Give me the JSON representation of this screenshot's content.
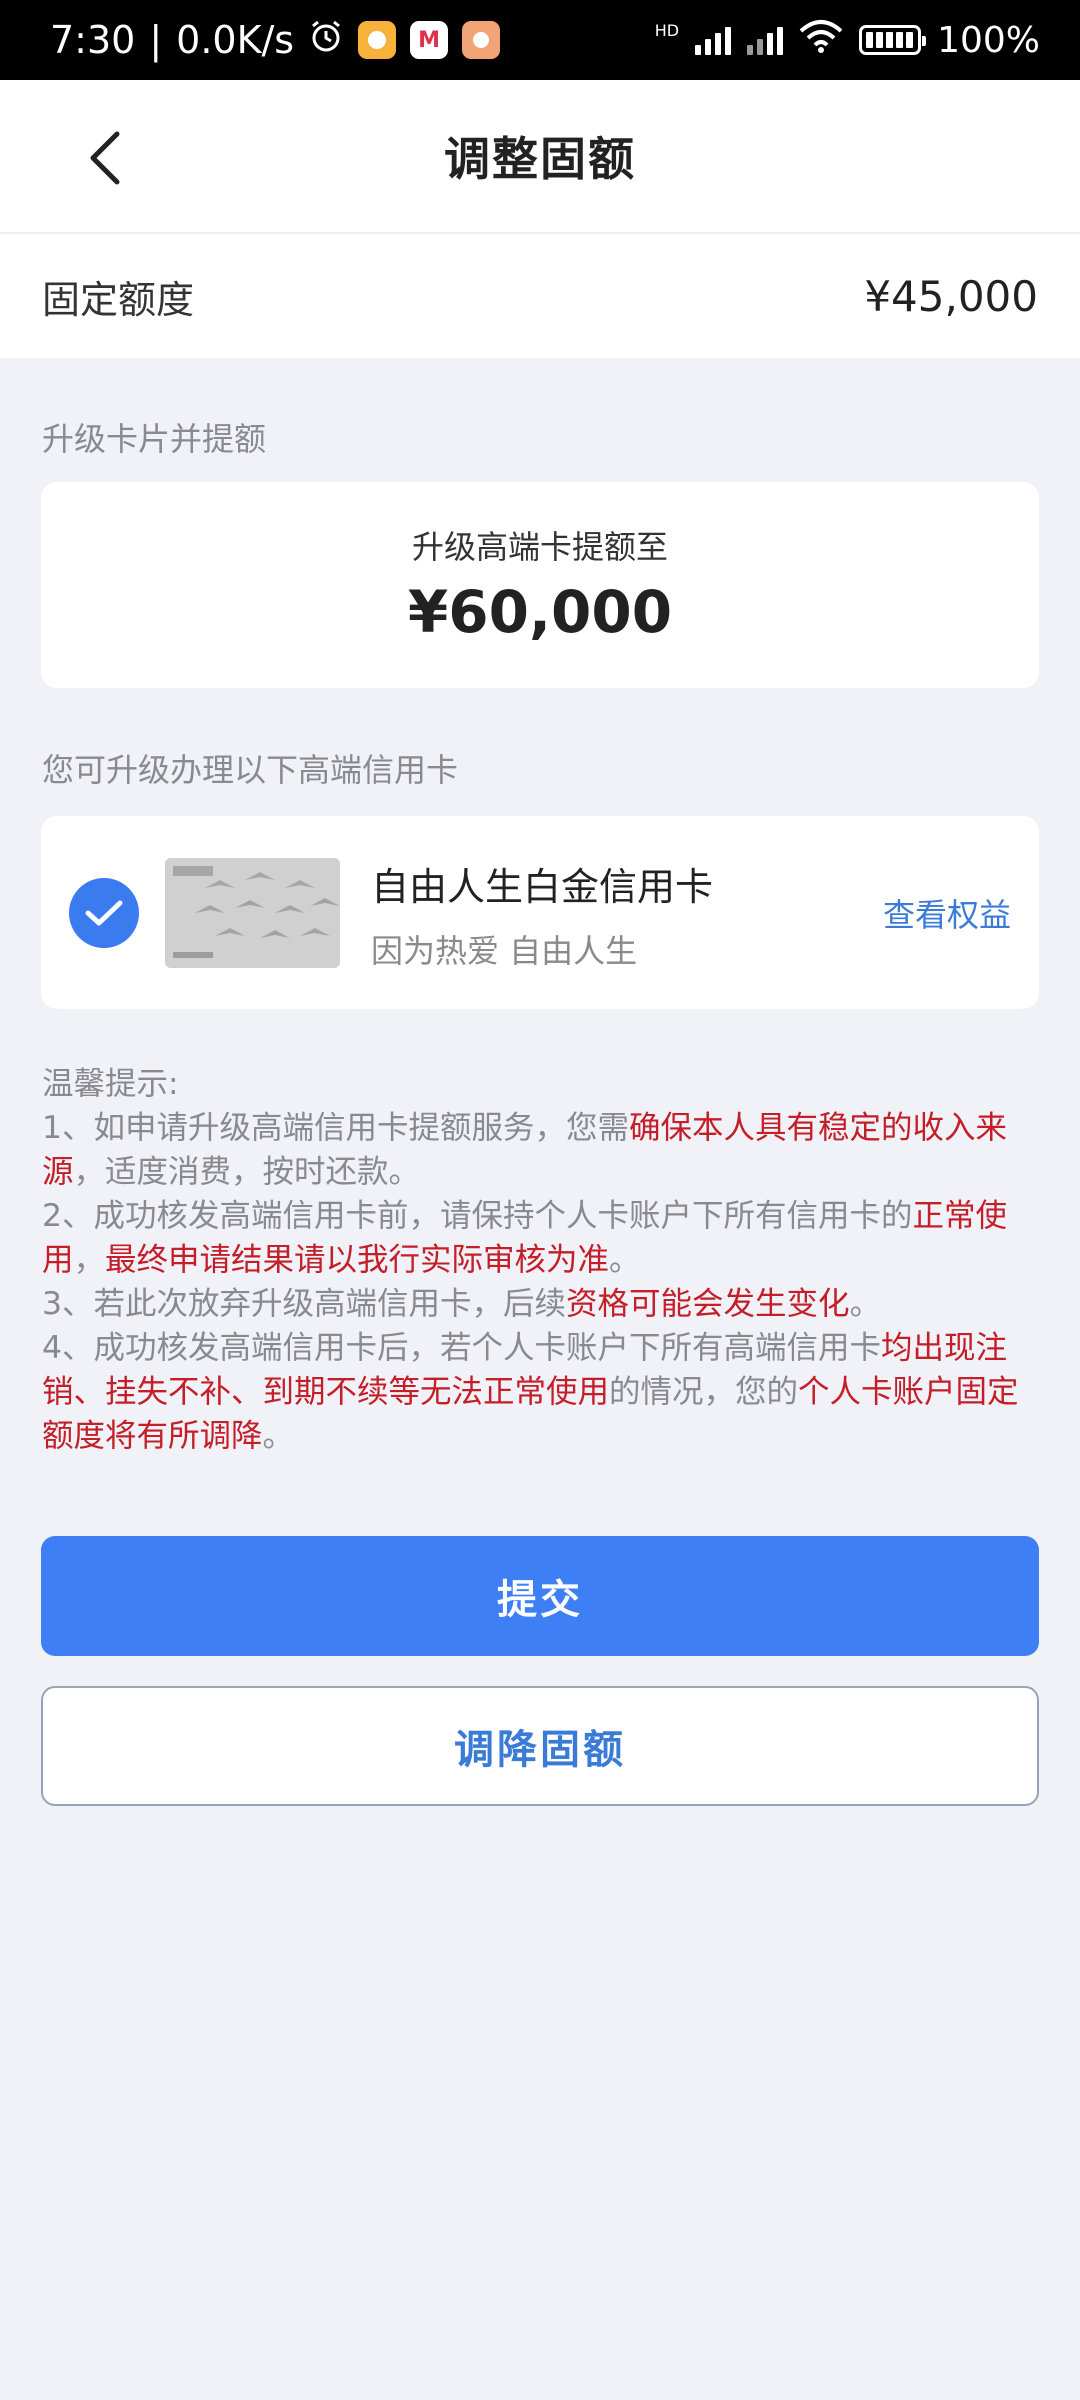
{
  "status_bar": {
    "time": "7:30",
    "speed": "0.0K/s",
    "hd": "HD",
    "battery": "100%"
  },
  "header": {
    "title": "调整固额"
  },
  "fixed_limit": {
    "label": "固定额度",
    "value": "¥45,000"
  },
  "upgrade_section": {
    "label": "升级卡片并提额",
    "subtitle": "升级高端卡提额至",
    "amount": "¥60,000"
  },
  "cards_section": {
    "label": "您可升级办理以下高端信用卡",
    "cards": [
      {
        "name": "自由人生白金信用卡",
        "slogan": "因为热爱 自由人生",
        "link": "查看权益",
        "selected": true
      }
    ]
  },
  "tips": {
    "title": "温馨提示:",
    "t1a": "1、如申请升级高端信用卡提额服务，您需",
    "t1b": "确保本人具有稳定的收入来源",
    "t1c": "，适度消费，按时还款。",
    "t2a": "2、成功核发高端信用卡前，请保持个人卡账户下所有信用卡的",
    "t2b": "正常使用",
    "t2c": "，",
    "t2d": "最终申请结果请以我行实际审核为准",
    "t2e": "。",
    "t3a": "3、若此次放弃升级高端信用卡，后续",
    "t3b": "资格可能会发生变化",
    "t3c": "。",
    "t4a": "4、成功核发高端信用卡后，若个人卡账户下所有高端信用卡",
    "t4b": "均出现注销、挂失不补、到期不续等无法正常使用",
    "t4c": "的情况，您的",
    "t4d": "个人卡账户固定额度将有所调降",
    "t4e": "。"
  },
  "buttons": {
    "submit": "提交",
    "reduce": "调降固额"
  },
  "colors": {
    "primary": "#3e7ff5",
    "link": "#3b7bd8",
    "warning_red": "#c41e28",
    "background": "#f1f2f7"
  }
}
